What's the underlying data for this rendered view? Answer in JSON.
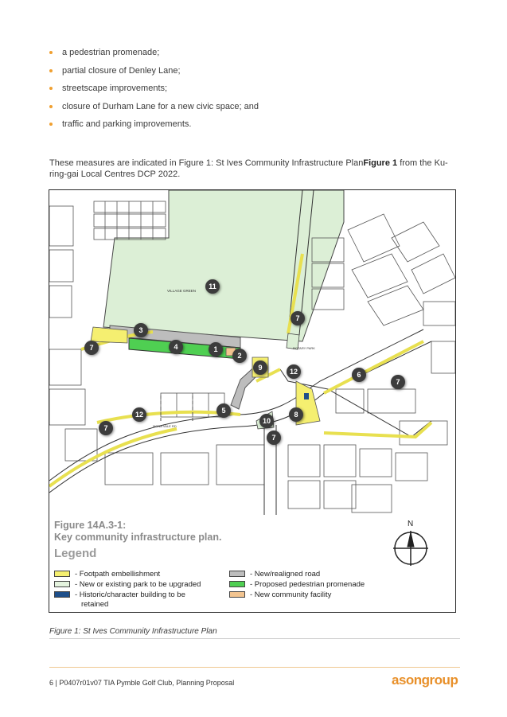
{
  "bullets": [
    "a pedestrian promenade;",
    "partial closure of Denley Lane;",
    "streetscape improvements;",
    "closure of Durham Lane for a new civic space; and",
    "traffic and parking improvements."
  ],
  "paragraph": {
    "before": "These measures are indicated in Figure 1: St Ives Community Infrastructure Plan",
    "bold": "Figure 1",
    "after": " from the Ku-ring-gai Local Centres DCP 2022."
  },
  "figure": {
    "title_line1": "Figure 14A.3-1:",
    "title_line2": "Key community infrastructure plan.",
    "legend_title": "Legend",
    "north": "N",
    "street_labels": {
      "village_green": "VILLAGE GREEN",
      "rotary_park": "ROTARY PARK",
      "mona_vale_rd": "MONA VALE RD"
    },
    "legend": [
      {
        "label": "- Footpath embellishment",
        "color": "#f5ef70"
      },
      {
        "label": "- New or existing park to be upgraded",
        "color": "#e4f3de"
      },
      {
        "label": "- Historic/character building to be",
        "label2": "retained",
        "color": "#1e4f8a"
      },
      {
        "label": "- New/realigned road",
        "color": "#bdbdbd"
      },
      {
        "label": "- Proposed pedestrian promenade",
        "color": "#4fcf52"
      },
      {
        "label": "- New community facility",
        "color": "#f2c490"
      }
    ],
    "markers": [
      "11",
      "3",
      "7",
      "4",
      "1",
      "2",
      "7",
      "9",
      "12",
      "6",
      "7",
      "5",
      "12",
      "7",
      "10",
      "8",
      "7"
    ]
  },
  "caption": "Figure 1: St Ives Community Infrastructure Plan",
  "footer": "6 | P0407r01v07 TIA Pymble Golf Club, Planning Proposal",
  "logo": "asongroup",
  "colors": {
    "accent": "#e8902a",
    "bullet": "#f0a030"
  }
}
